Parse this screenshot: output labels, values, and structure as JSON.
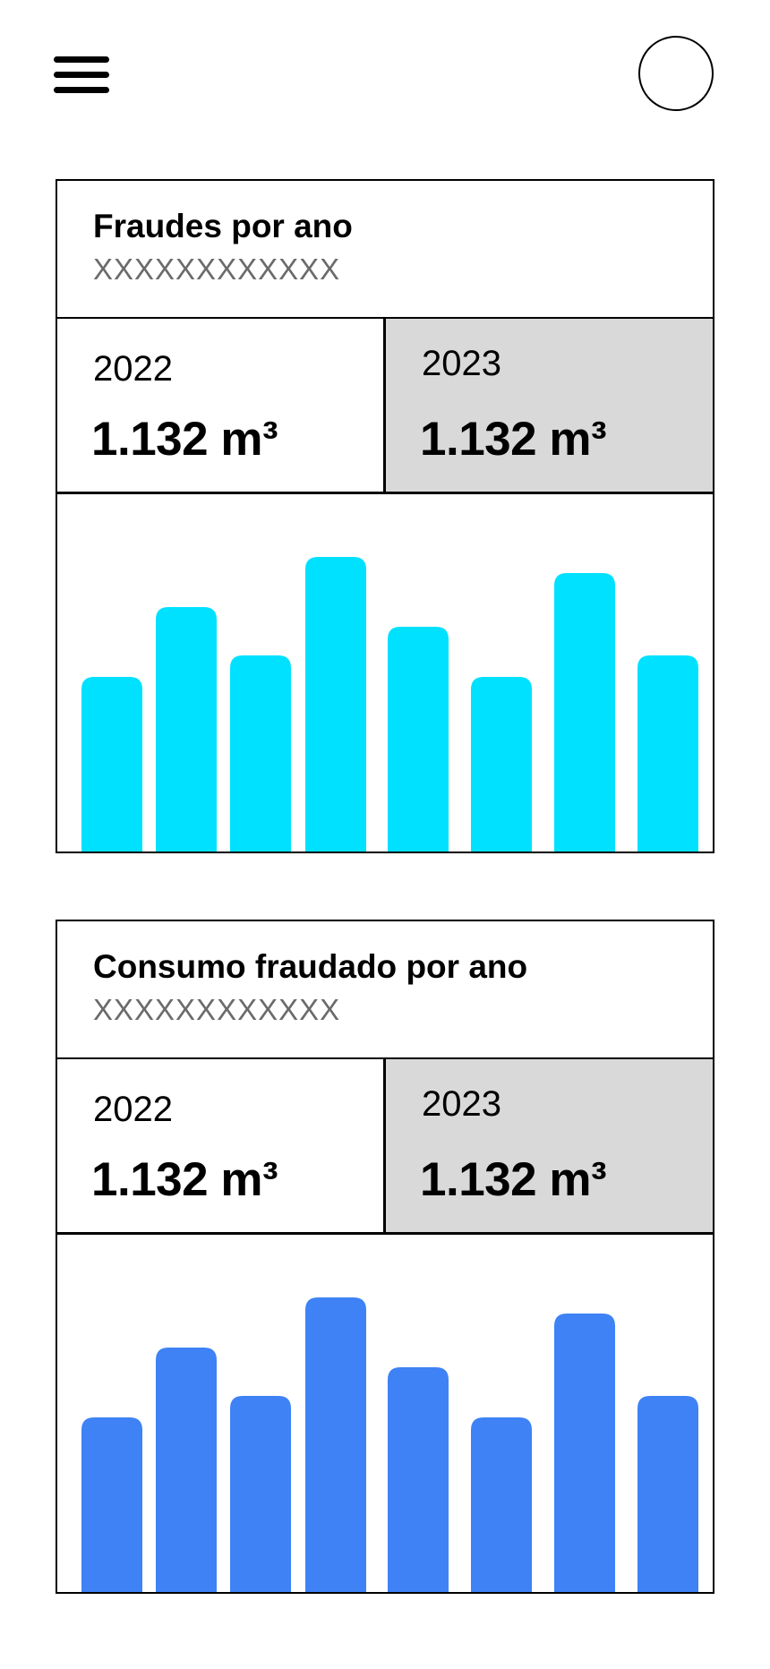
{
  "cards": [
    {
      "title": "Fraudes por ano",
      "subtitle": "XXXXXXXXXXXX",
      "stats": [
        {
          "year": "2022",
          "value": "1.132 m³"
        },
        {
          "year": "2023",
          "value": "1.132 m³"
        }
      ],
      "chart_data": {
        "type": "bar",
        "values": [
          195,
          273,
          219,
          329,
          251,
          195,
          311,
          219
        ],
        "ylim": [
          0,
          340
        ],
        "color": "#00e1ff"
      }
    },
    {
      "title": "Consumo fraudado por ano",
      "subtitle": "XXXXXXXXXXXX",
      "stats": [
        {
          "year": "2022",
          "value": "1.132 m³"
        },
        {
          "year": "2023",
          "value": "1.132 m³"
        }
      ],
      "chart_data": {
        "type": "bar",
        "values": [
          195,
          273,
          219,
          329,
          251,
          195,
          311,
          219
        ],
        "ylim": [
          0,
          340
        ],
        "color": "#3e82f5"
      }
    }
  ],
  "icons": {
    "menu": "hamburger-menu-icon",
    "avatar": "user-avatar-circle"
  }
}
